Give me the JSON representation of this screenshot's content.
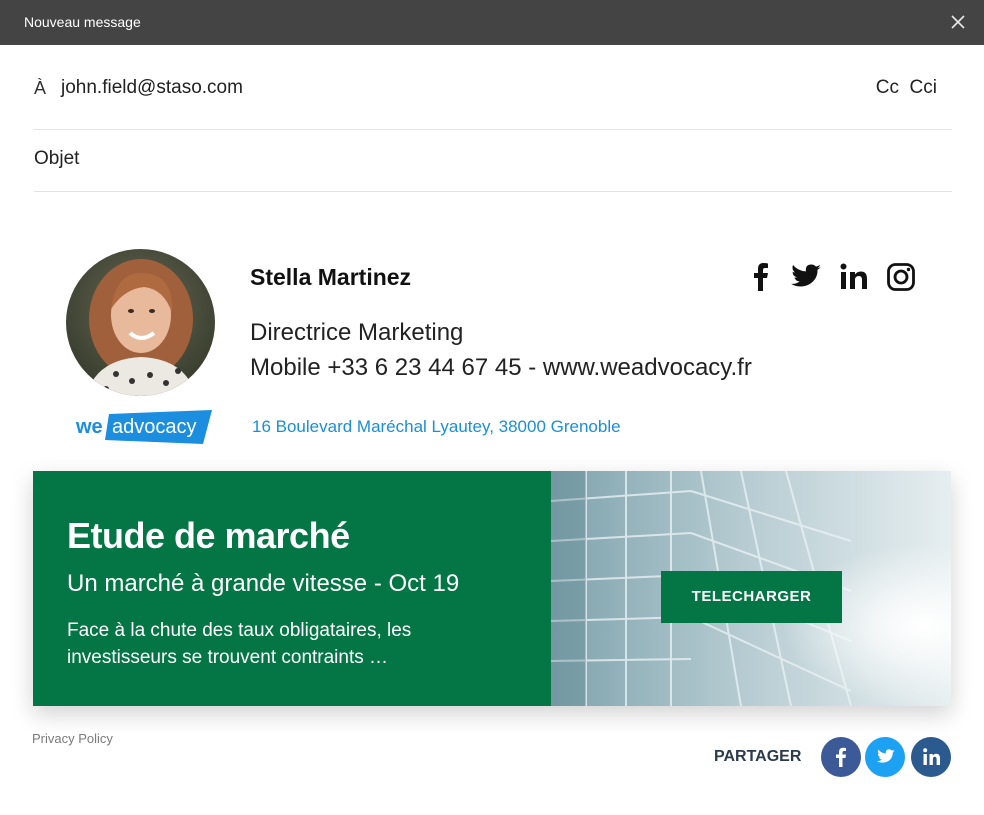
{
  "window": {
    "title": "Nouveau message"
  },
  "compose": {
    "to_label": "À",
    "to_value": "john.field@staso.com",
    "cc_label": "Cc",
    "cci_label": "Cci",
    "subject_label": "Objet"
  },
  "signature": {
    "name": "Stella Martinez",
    "title": "Directrice Marketing",
    "contact": "Mobile +33 6 23 44 67 45 - www.weadvocacy.fr",
    "address": "16 Boulevard Maréchal Lyautey, 38000 Grenoble",
    "logo": {
      "part1": "we",
      "part2": "advocacy"
    },
    "socials": [
      "facebook-icon",
      "twitter-icon",
      "linkedin-icon",
      "instagram-icon"
    ]
  },
  "banner": {
    "title": "Etude de marché",
    "subtitle": "Un marché à grande vitesse - Oct 19",
    "description": "Face à la chute des taux obligataires, les investisseurs se trouvent contraints …",
    "button": "TELECHARGER",
    "color": "#047645"
  },
  "footer": {
    "privacy": "Privacy Policy",
    "share_label": "PARTAGER",
    "share": [
      {
        "icon": "facebook-icon",
        "color": "#3d5a98"
      },
      {
        "icon": "twitter-icon",
        "color": "#1da1f2"
      },
      {
        "icon": "linkedin-icon",
        "color": "#2a5a8e"
      }
    ]
  }
}
